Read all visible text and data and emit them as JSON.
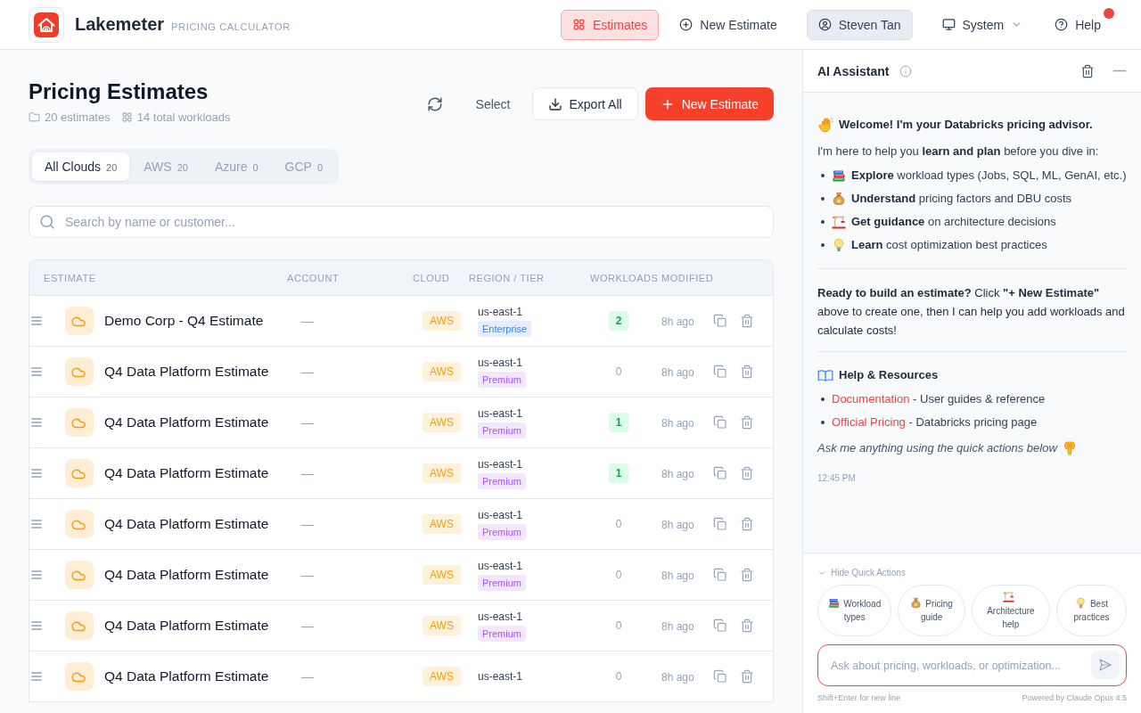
{
  "app": {
    "name": "Lakemeter",
    "subtitle": "PRICING CALCULATOR"
  },
  "nav": [
    {
      "kind": "estimates",
      "label": "Estimates",
      "selected": true,
      "notification": false
    },
    {
      "kind": "create",
      "label": "New Estimate",
      "selected": false,
      "notification": false
    },
    {
      "kind": "user",
      "label": "Steven Tan",
      "selected": false,
      "notification": false
    },
    {
      "kind": "system",
      "label": "System",
      "selected": false,
      "notification": false
    },
    {
      "kind": "help",
      "label": "Help",
      "selected": false,
      "notification": true
    }
  ],
  "page": {
    "title": "Pricing Estimates",
    "stats": [
      {
        "kind": "estimates",
        "text": "20 estimates"
      },
      {
        "kind": "workloads",
        "text": "14 total workloads"
      }
    ],
    "actions": [
      {
        "kind": "refresh"
      },
      {
        "kind": "text",
        "label": "Select"
      },
      {
        "kind": "outline",
        "label": "Export All"
      },
      {
        "kind": "primary",
        "label": "New Estimate"
      }
    ]
  },
  "cloud_tabs": [
    {
      "label": "All Clouds",
      "count": "20",
      "selected": true
    },
    {
      "label": "AWS",
      "count": "20",
      "selected": false
    },
    {
      "label": "Azure",
      "count": "0",
      "selected": false
    },
    {
      "label": "GCP",
      "count": "0",
      "selected": false
    }
  ],
  "search": {
    "placeholder": "Search by name or customer..."
  },
  "table": {
    "columns": [
      "ESTIMATE",
      "ACCOUNT",
      "CLOUD",
      "REGION / TIER",
      "WORKLOADS",
      "MODIFIED"
    ],
    "rows": [
      {
        "name": "Demo Corp - Q4 Estimate",
        "account": "—",
        "cloud": "AWS",
        "region": "us-east-1",
        "tier": {
          "label": "Enterprise",
          "color": "#3b82f6"
        },
        "workloads": "2",
        "has_workloads": true,
        "modified": "8h ago"
      },
      {
        "name": "Q4 Data Platform Estimate",
        "account": "—",
        "cloud": "AWS",
        "region": "us-east-1",
        "tier": {
          "label": "Premium",
          "color": "#a855f7"
        },
        "workloads": "0",
        "has_workloads": false,
        "modified": "8h ago"
      },
      {
        "name": "Q4 Data Platform Estimate",
        "account": "—",
        "cloud": "AWS",
        "region": "us-east-1",
        "tier": {
          "label": "Premium",
          "color": "#a855f7"
        },
        "workloads": "1",
        "has_workloads": true,
        "modified": "8h ago"
      },
      {
        "name": "Q4 Data Platform Estimate",
        "account": "—",
        "cloud": "AWS",
        "region": "us-east-1",
        "tier": {
          "label": "Premium",
          "color": "#a855f7"
        },
        "workloads": "1",
        "has_workloads": true,
        "modified": "8h ago"
      },
      {
        "name": "Q4 Data Platform Estimate",
        "account": "—",
        "cloud": "AWS",
        "region": "us-east-1",
        "tier": {
          "label": "Premium",
          "color": "#a855f7"
        },
        "workloads": "0",
        "has_workloads": false,
        "modified": "8h ago"
      },
      {
        "name": "Q4 Data Platform Estimate",
        "account": "—",
        "cloud": "AWS",
        "region": "us-east-1",
        "tier": {
          "label": "Premium",
          "color": "#a855f7"
        },
        "workloads": "0",
        "has_workloads": false,
        "modified": "8h ago"
      },
      {
        "name": "Q4 Data Platform Estimate",
        "account": "—",
        "cloud": "AWS",
        "region": "us-east-1",
        "tier": {
          "label": "Premium",
          "color": "#a855f7"
        },
        "workloads": "0",
        "has_workloads": false,
        "modified": "8h ago"
      },
      {
        "name": "Q4 Data Platform Estimate",
        "account": "—",
        "cloud": "AWS",
        "region": "us-east-1",
        "workloads": "0",
        "has_workloads": false,
        "modified": "8h ago"
      }
    ]
  },
  "assistant": {
    "title": "AI Assistant",
    "welcome": "Welcome! I'm your Databricks pricing advisor.",
    "intro": "I'm here to help you **learn and plan** before you dive in:",
    "features": [
      "**Explore** workload types (Jobs, SQL, ML, GenAI, etc.)",
      "**Understand** pricing factors and DBU costs",
      "**Get guidance** on architecture decisions",
      "**Learn** cost optimization best practices"
    ],
    "call_to_action": "**Ready to build an estimate?** Click **\"+ New Estimate\"** above to create one, then I can help you add workloads and calculate costs!",
    "resources_title": "Help & Resources",
    "resources": [
      {
        "link": "Documentation",
        "text": "- User guides & reference"
      },
      {
        "link": "Official Pricing",
        "text": "- Databricks pricing page"
      }
    ],
    "closing": "Ask me anything using the quick actions below",
    "time": "12:45 PM",
    "quick_actions": {
      "toggle": "Hide Quick Actions",
      "expanded": true,
      "items": [
        "Workload types",
        "Pricing guide",
        "Architecture help",
        "Best practices"
      ]
    },
    "input": {
      "placeholder": "Ask about pricing, workloads, or optimization..."
    },
    "hint": "Shift+Enter for new line",
    "powered_by": "Powered by Claude Opus 4.5"
  }
}
